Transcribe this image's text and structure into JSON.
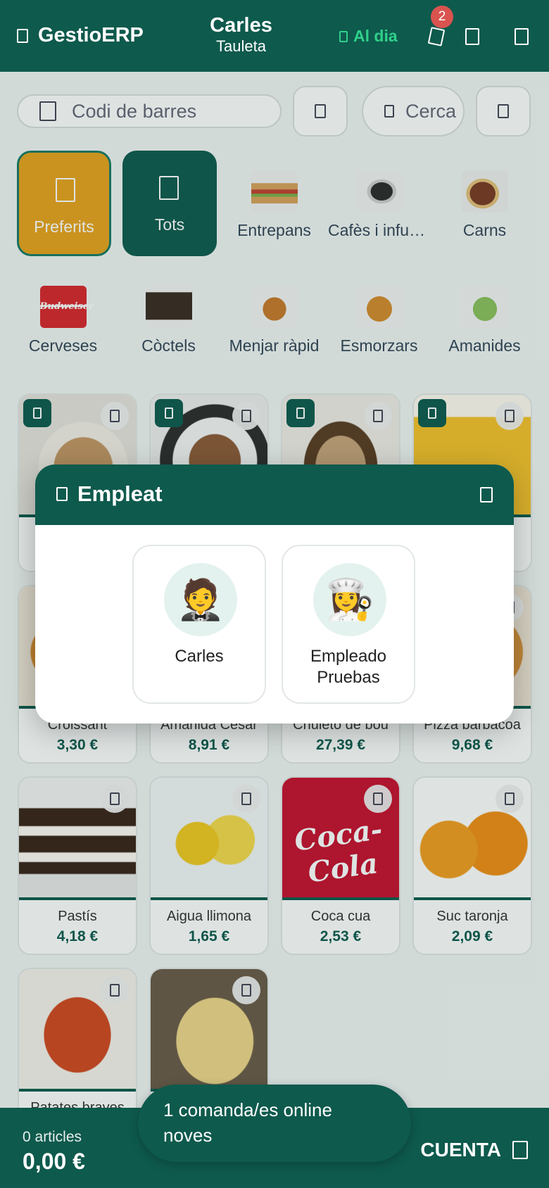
{
  "header": {
    "brand": "GestioERP",
    "user_name": "Carles",
    "device": "Tauleta",
    "status": "Al dia",
    "notification_count": "2"
  },
  "search": {
    "barcode_placeholder": "Codi de barres",
    "search_placeholder": "Cerca"
  },
  "categories": {
    "favorites": "Preferits",
    "all": "Tots",
    "items": [
      {
        "label": "Entrepans"
      },
      {
        "label": "Cafès i infusions"
      },
      {
        "label": "Carns"
      },
      {
        "label": "Cerveses",
        "logo_text": "Budweiser"
      },
      {
        "label": "Còctels"
      },
      {
        "label": "Menjar ràpid"
      },
      {
        "label": "Esmorzars"
      },
      {
        "label": "Amanides"
      }
    ]
  },
  "products": [
    {
      "name": "Croissant",
      "price": "3,30 €"
    },
    {
      "name": "Amanida Cèsar",
      "price": "8,91 €"
    },
    {
      "name": "Chuletó de bou",
      "price": "27,39 €"
    },
    {
      "name": "Pizza barbacoa",
      "price": "9,68 €"
    },
    {
      "name": "Pastís",
      "price": "4,18 €"
    },
    {
      "name": "Aigua llimona",
      "price": "1,65 €"
    },
    {
      "name": "Coca cua",
      "price": "2,53 €",
      "logo_text": "Coca-Cola"
    },
    {
      "name": "Suc taronja",
      "price": "2,09 €"
    },
    {
      "name": "Patates braves",
      "price": ""
    },
    {
      "name": "",
      "price": ""
    }
  ],
  "modal": {
    "title": "Empleat",
    "employees": [
      {
        "name": "Carles",
        "avatar": "🤵"
      },
      {
        "name": "Empleado Pruebas",
        "avatar": "👩‍🍳"
      }
    ]
  },
  "footer": {
    "articles": "0 articles",
    "total": "0,00 €",
    "checkout": "CUENTA"
  },
  "toast": {
    "message": "1 comanda/es online noves"
  },
  "colors": {
    "primary": "#0e5a4d",
    "favorites": "#e8a21c",
    "status": "#2fd08a",
    "badge": "#d9534f"
  }
}
